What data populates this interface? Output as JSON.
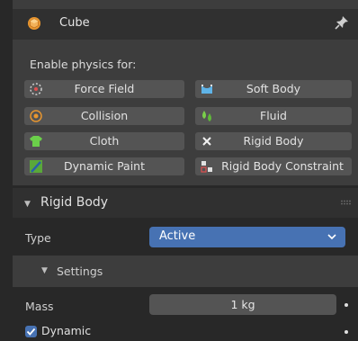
{
  "object": {
    "name": "Cube"
  },
  "physics": {
    "enable_label": "Enable physics for:",
    "buttons": [
      {
        "label": "Force Field"
      },
      {
        "label": "Soft Body"
      },
      {
        "label": "Collision"
      },
      {
        "label": "Fluid"
      },
      {
        "label": "Cloth"
      },
      {
        "label": "Rigid Body"
      },
      {
        "label": "Dynamic Paint"
      },
      {
        "label": "Rigid Body Constraint"
      }
    ]
  },
  "rigid_body": {
    "title": "Rigid Body",
    "type_label": "Type",
    "type_value": "Active",
    "settings_label": "Settings",
    "mass_label": "Mass",
    "mass_value": "1 kg",
    "dynamic_label": "Dynamic",
    "dynamic_checked": true
  },
  "colors": {
    "accent": "#4772b3",
    "button": "#545454",
    "panel": "#3d3d3d",
    "header": "#303030",
    "background": "#282828"
  },
  "icons": [
    "cube-icon",
    "pin-icon",
    "force-field-icon",
    "soft-body-icon",
    "collision-icon",
    "fluid-icon",
    "cloth-icon",
    "close-x-icon",
    "dynamic-paint-icon",
    "rigid-body-constraint-icon",
    "chevron-down-icon",
    "checkbox-icon"
  ]
}
